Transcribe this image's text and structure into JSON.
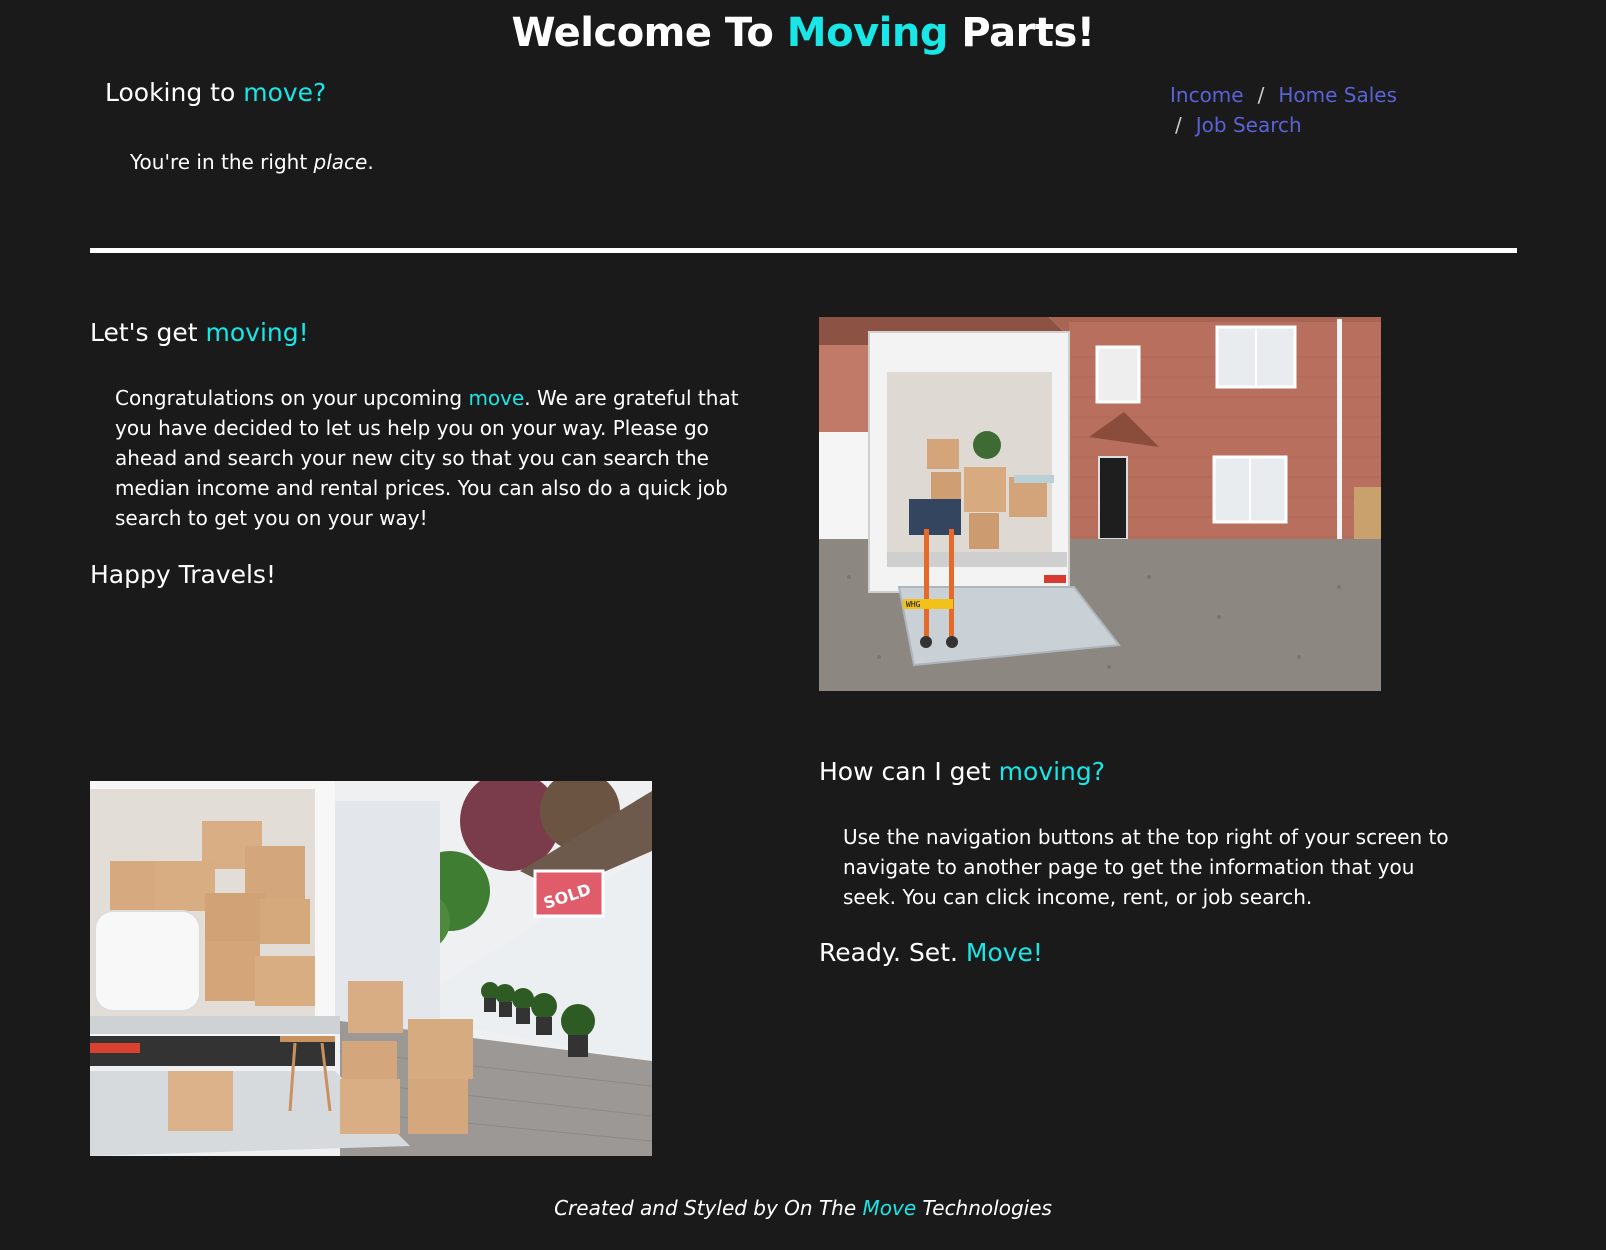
{
  "title": {
    "pre": "Welcome To ",
    "accent": "Moving",
    "post": " Parts!"
  },
  "intro": {
    "heading_pre": "Looking to ",
    "heading_accent": "move?",
    "text_pre": "You're in the right ",
    "text_em": "place",
    "text_post": "."
  },
  "nav": {
    "items": [
      {
        "label": "Income"
      },
      {
        "label": "Home Sales"
      },
      {
        "label": "Job Search"
      }
    ],
    "separator": "/"
  },
  "section1": {
    "heading_pre": "Let's get ",
    "heading_accent": "moving!",
    "para_pre": "Congratulations on your upcoming ",
    "para_accent": "move",
    "para_post": ". We are grateful that you have decided to let us help you on your way. Please go ahead and search your new city so that you can search the median income and rental prices. You can also do a quick job search to get you on your way!",
    "closing": "Happy Travels!"
  },
  "section2": {
    "heading_pre": "How can I get ",
    "heading_accent": "moving?",
    "para": "Use the navigation buttons at the top right of your screen to navigate to another page to get the information that you seek. You can click income, rent, or job search.",
    "closing_pre": "Ready. Set. ",
    "closing_accent": "Move!"
  },
  "images": {
    "sign_text": "SOLD",
    "plate_text": "WHG"
  },
  "footer": {
    "pre": "Created and Styled by On The ",
    "accent": "Move",
    "post": " Technologies"
  },
  "colors": {
    "background": "#1a1a1b",
    "accent": "#19e6e6",
    "link": "#5a63d6",
    "text": "#ffffff"
  }
}
